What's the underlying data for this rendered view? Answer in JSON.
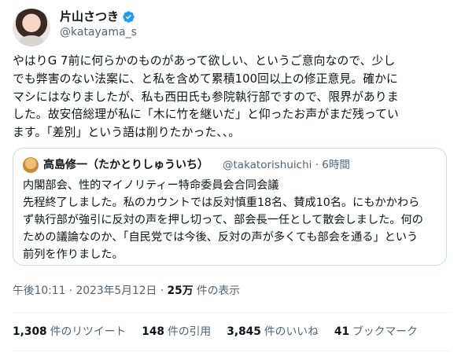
{
  "author": {
    "display_name": "片山さつき",
    "handle": "@katayama_s",
    "verified_icon": "verified-badge-icon",
    "verified_color": "#1d9bf0"
  },
  "tweet": {
    "text": "やはりG 7前に何らかのものがあって欲しい、というご意向なので、少し\nでも弊害のない法案に、と私を含めて累積100回以上の修正意見。確かに\nマシにはなりましたが、私も西田氏も参院執行部ですので、限界がありま\nした。故安倍総理が私に「木に竹を継いだ」と仰ったお声がまだ残ってい\nます。「差別」という語は削りたかった、、。"
  },
  "quote": {
    "display_name": "高島修一（たかとりしゅういち）",
    "handle": "@takatorishuichi",
    "separator": "·",
    "time": "6時間",
    "text": "内閣部会、性的マイノリティー特命委員会合同会議\n先程終了しました。私のカウントでは反対慎重18名、賛成10名。にもかかわら\nず執行部が強引に反対の声を押し切って、部会長一任として散会しました。何の\nための議論なのか、「自民党では今後、反対の声が多くても部会を通る」という\n前列を作りました。"
  },
  "meta": {
    "timestamp": "午後10:11 · 2023年5月12日 · ",
    "views_count": "25万",
    "views_label": " 件の表示"
  },
  "stats": {
    "retweets_count": "1,308",
    "retweets_label": "件のリツイート",
    "quotes_count": "148",
    "quotes_label": "件の引用",
    "likes_count": "3,845",
    "likes_label": "件のいいね",
    "bookmarks_count": "41",
    "bookmarks_label": "ブックマーク"
  }
}
